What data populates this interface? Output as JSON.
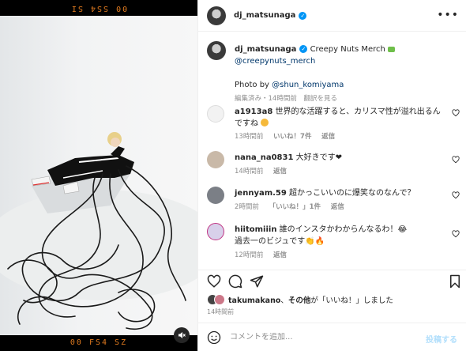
{
  "photo": {
    "film_top_text": "00 SS4 SI",
    "film_bottom_text": "00 FS4 SZ"
  },
  "header": {
    "username": "dj_matsunaga",
    "verified_icon": "verified-badge-icon",
    "more_icon": "more-horizontal-icon"
  },
  "caption": {
    "username": "dj_matsunaga",
    "text": "Creepy Nuts Merch",
    "mention": "@creepynuts_merch",
    "photo_by_prefix": "Photo by ",
    "photo_by_mention": "@shun_komiyama",
    "meta_edited": "編集済み・14時間前",
    "meta_translate": "翻訳を見る"
  },
  "comments": [
    {
      "username": "a1913a8",
      "text": "世界的な活躍すると、カリスマ性が溢れ出るんですね",
      "time": "13時間前",
      "likes": "いいね！7件",
      "reply": "返信",
      "avatar_color": "#f2f2f2"
    },
    {
      "username": "nana_na0831",
      "text": "大好きです❤",
      "time": "14時間前",
      "likes": "",
      "reply": "返信",
      "avatar_color": "#c9b9a8"
    },
    {
      "username": "jennyam.59",
      "text": "超かっこいいのに爆笑なのなんで？",
      "time": "2時間前",
      "likes": "「いいね！」1件",
      "reply": "返信",
      "avatar_color": "#7b7f86"
    },
    {
      "username": "hiitomiiin",
      "text": "誰のインスタかわからんなるわ！😂",
      "text2": "過去一のビジュです👏🔥",
      "time": "12時間前",
      "likes": "",
      "reply": "返信",
      "avatar_color": "#d8d0ea"
    }
  ],
  "actions": {
    "like_icon": "heart-icon",
    "comment_icon": "comment-icon",
    "share_icon": "share-icon",
    "save_icon": "bookmark-icon"
  },
  "likes": {
    "user": "takumakano",
    "sep": "、",
    "others": "その他",
    "suffix": "が「いいね！」しました"
  },
  "timestamp": "14時間前",
  "add_comment": {
    "placeholder": "コメントを追加...",
    "post_label": "投稿する"
  },
  "colors": {
    "link": "#00376b",
    "accent": "#0095f6",
    "muted": "#8e8e8e",
    "film": "#e07a1f"
  }
}
